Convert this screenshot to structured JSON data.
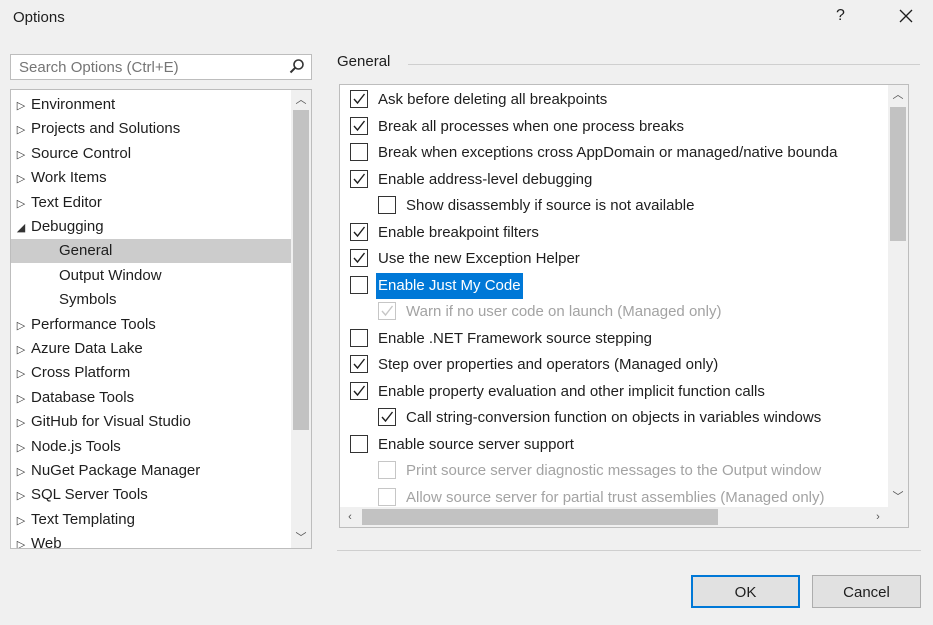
{
  "window": {
    "title": "Options",
    "help_label": "?",
    "close_label": "✕"
  },
  "search": {
    "placeholder": "Search Options (Ctrl+E)"
  },
  "tree": {
    "items": [
      {
        "label": "Environment",
        "arrow": "▷",
        "level": 0
      },
      {
        "label": "Projects and Solutions",
        "arrow": "▷",
        "level": 0
      },
      {
        "label": "Source Control",
        "arrow": "▷",
        "level": 0
      },
      {
        "label": "Work Items",
        "arrow": "▷",
        "level": 0
      },
      {
        "label": "Text Editor",
        "arrow": "▷",
        "level": 0
      },
      {
        "label": "Debugging",
        "arrow": "◢",
        "level": 0
      },
      {
        "label": "General",
        "arrow": "",
        "level": 1,
        "selected": true
      },
      {
        "label": "Output Window",
        "arrow": "",
        "level": 1
      },
      {
        "label": "Symbols",
        "arrow": "",
        "level": 1
      },
      {
        "label": "Performance Tools",
        "arrow": "▷",
        "level": 0
      },
      {
        "label": "Azure Data Lake",
        "arrow": "▷",
        "level": 0
      },
      {
        "label": "Cross Platform",
        "arrow": "▷",
        "level": 0
      },
      {
        "label": "Database Tools",
        "arrow": "▷",
        "level": 0
      },
      {
        "label": "GitHub for Visual Studio",
        "arrow": "▷",
        "level": 0
      },
      {
        "label": "Node.js Tools",
        "arrow": "▷",
        "level": 0
      },
      {
        "label": "NuGet Package Manager",
        "arrow": "▷",
        "level": 0
      },
      {
        "label": "SQL Server Tools",
        "arrow": "▷",
        "level": 0
      },
      {
        "label": "Text Templating",
        "arrow": "▷",
        "level": 0
      },
      {
        "label": "Web",
        "arrow": "▷",
        "level": 0
      }
    ]
  },
  "group": {
    "label": "General"
  },
  "options": [
    {
      "label": "Ask before deleting all breakpoints",
      "checked": true,
      "indent": 0
    },
    {
      "label": "Break all processes when one process breaks",
      "checked": true,
      "indent": 0
    },
    {
      "label": "Break when exceptions cross AppDomain or managed/native bounda",
      "checked": false,
      "indent": 0
    },
    {
      "label": "Enable address-level debugging",
      "checked": true,
      "indent": 0
    },
    {
      "label": "Show disassembly if source is not available",
      "checked": false,
      "indent": 1
    },
    {
      "label": "Enable breakpoint filters",
      "checked": true,
      "indent": 0
    },
    {
      "label": "Use the new Exception Helper",
      "checked": true,
      "indent": 0
    },
    {
      "label": "Enable Just My Code",
      "checked": false,
      "indent": 0,
      "highlighted": true
    },
    {
      "label": "Warn if no user code on launch (Managed only)",
      "checked": true,
      "indent": 1,
      "disabled": true
    },
    {
      "label": "Enable .NET Framework source stepping",
      "checked": false,
      "indent": 0
    },
    {
      "label": "Step over properties and operators (Managed only)",
      "checked": true,
      "indent": 0
    },
    {
      "label": "Enable property evaluation and other implicit function calls",
      "checked": true,
      "indent": 0
    },
    {
      "label": "Call string-conversion function on objects in variables windows",
      "checked": true,
      "indent": 1
    },
    {
      "label": "Enable source server support",
      "checked": false,
      "indent": 0
    },
    {
      "label": "Print source server diagnostic messages to the Output window",
      "checked": false,
      "indent": 1,
      "disabled": true
    },
    {
      "label": "Allow source server for partial trust assemblies (Managed only)",
      "checked": false,
      "indent": 1,
      "disabled": true
    }
  ],
  "buttons": {
    "ok": "OK",
    "cancel": "Cancel"
  }
}
